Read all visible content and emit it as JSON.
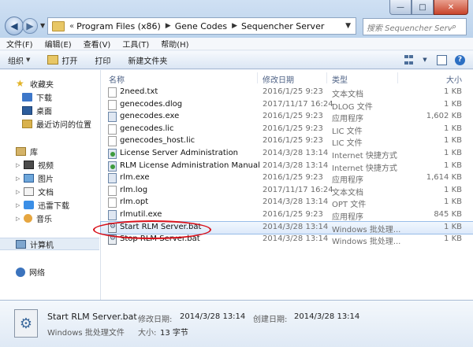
{
  "window": {
    "buttons": {
      "minimize": "—",
      "maximize": "□",
      "close": "✕"
    }
  },
  "address": {
    "overflow": "«",
    "crumbs": [
      "Program Files (x86)",
      "Gene Codes",
      "Sequencher Server"
    ]
  },
  "search": {
    "placeholder": "搜索 Sequencher Server"
  },
  "menu": [
    "文件(F)",
    "编辑(E)",
    "查看(V)",
    "工具(T)",
    "帮助(H)"
  ],
  "toolbar": {
    "organize": "组织",
    "open": "打开",
    "print": "打印",
    "new_folder": "新建文件夹"
  },
  "nav": {
    "favorites": "收藏夹",
    "downloads": "下载",
    "desktop": "桌面",
    "recent": "最近访问的位置",
    "libraries": "库",
    "videos": "视频",
    "pictures": "图片",
    "documents": "文档",
    "xunlei": "迅雷下载",
    "music": "音乐",
    "computer": "计算机",
    "network": "网络"
  },
  "columns": {
    "name": "名称",
    "date": "修改日期",
    "type": "类型",
    "size": "大小"
  },
  "files": [
    {
      "name": "2need.txt",
      "date": "2016/1/25 9:23",
      "type": "文本文档",
      "size": "1 KB",
      "icon": "txt"
    },
    {
      "name": "genecodes.dlog",
      "date": "2017/11/17 16:24",
      "type": "DLOG 文件",
      "size": "1 KB",
      "icon": "txt"
    },
    {
      "name": "genecodes.exe",
      "date": "2016/1/25 9:23",
      "type": "应用程序",
      "size": "1,602 KB",
      "icon": "exe"
    },
    {
      "name": "genecodes.lic",
      "date": "2016/1/25 9:23",
      "type": "LIC 文件",
      "size": "1 KB",
      "icon": "txt"
    },
    {
      "name": "genecodes_host.lic",
      "date": "2016/1/25 9:23",
      "type": "LIC 文件",
      "size": "1 KB",
      "icon": "txt"
    },
    {
      "name": "License Server Administration",
      "date": "2014/3/28 13:14",
      "type": "Internet 快捷方式",
      "size": "1 KB",
      "icon": "url"
    },
    {
      "name": "RLM License Administration Manual",
      "date": "2014/3/28 13:14",
      "type": "Internet 快捷方式",
      "size": "1 KB",
      "icon": "url"
    },
    {
      "name": "rlm.exe",
      "date": "2016/1/25 9:23",
      "type": "应用程序",
      "size": "1,614 KB",
      "icon": "exe"
    },
    {
      "name": "rlm.log",
      "date": "2017/11/17 16:24",
      "type": "文本文档",
      "size": "1 KB",
      "icon": "txt"
    },
    {
      "name": "rlm.opt",
      "date": "2014/3/28 13:14",
      "type": "OPT 文件",
      "size": "1 KB",
      "icon": "txt"
    },
    {
      "name": "rlmutil.exe",
      "date": "2016/1/25 9:23",
      "type": "应用程序",
      "size": "845 KB",
      "icon": "exe"
    },
    {
      "name": "Start RLM Server.bat",
      "date": "2014/3/28 13:14",
      "type": "Windows 批处理...",
      "size": "1 KB",
      "icon": "bat",
      "selected": true
    },
    {
      "name": "Stop RLM Server.bat",
      "date": "2014/3/28 13:14",
      "type": "Windows 批处理...",
      "size": "1 KB",
      "icon": "bat"
    }
  ],
  "details": {
    "filename": "Start RLM Server.bat",
    "modified_label": "修改日期:",
    "modified": "2014/3/28 13:14",
    "created_label": "创建日期:",
    "created": "2014/3/28 13:14",
    "type": "Windows 批处理文件",
    "size_label": "大小:",
    "size": "13 字节"
  },
  "colors": {
    "selection_outline": "#98bde8",
    "annotation_oval": "#d9101a"
  }
}
